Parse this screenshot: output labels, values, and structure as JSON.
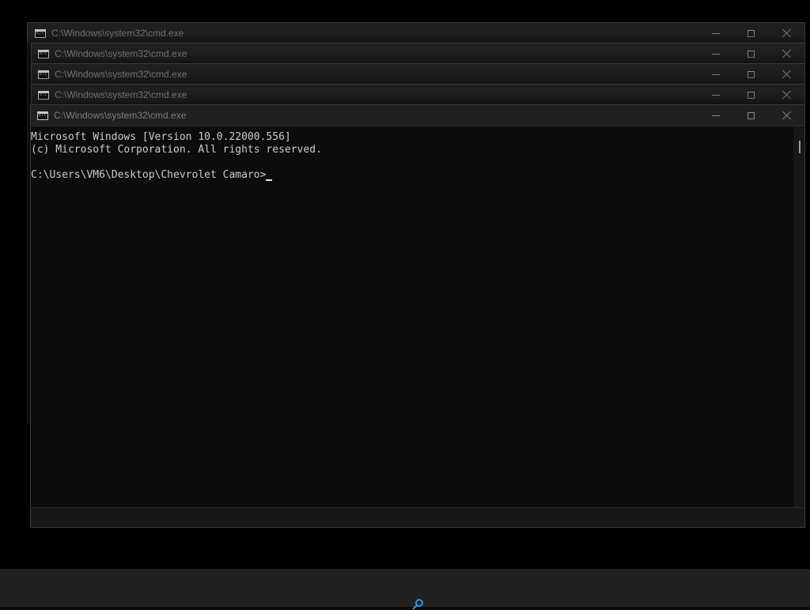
{
  "windows": [
    {
      "title": "C:\\Windows\\system32\\cmd.exe"
    },
    {
      "title": "C:\\Windows\\system32\\cmd.exe"
    },
    {
      "title": "C:\\Windows\\system32\\cmd.exe"
    },
    {
      "title": "C:\\Windows\\system32\\cmd.exe"
    },
    {
      "title": "C:\\Windows\\system32\\cmd.exe"
    }
  ],
  "console": {
    "line1": "Microsoft Windows [Version 10.0.22000.556]",
    "line2": "(c) Microsoft Corporation. All rights reserved.",
    "line3": "",
    "prompt": "C:\\Users\\VM6\\Desktop\\Chevrolet Camaro>"
  },
  "colors": {
    "console_bg": "#0c0c0c",
    "console_fg": "#cccccc",
    "titlebar_bg": "#202020",
    "taskbar_bg": "#202020",
    "accent": "#3a8ee6"
  },
  "icons": {
    "app": "cmd-icon",
    "minimize": "minimize-icon",
    "maximize": "maximize-icon",
    "close": "close-icon",
    "taskbar_search": "search-icon"
  }
}
